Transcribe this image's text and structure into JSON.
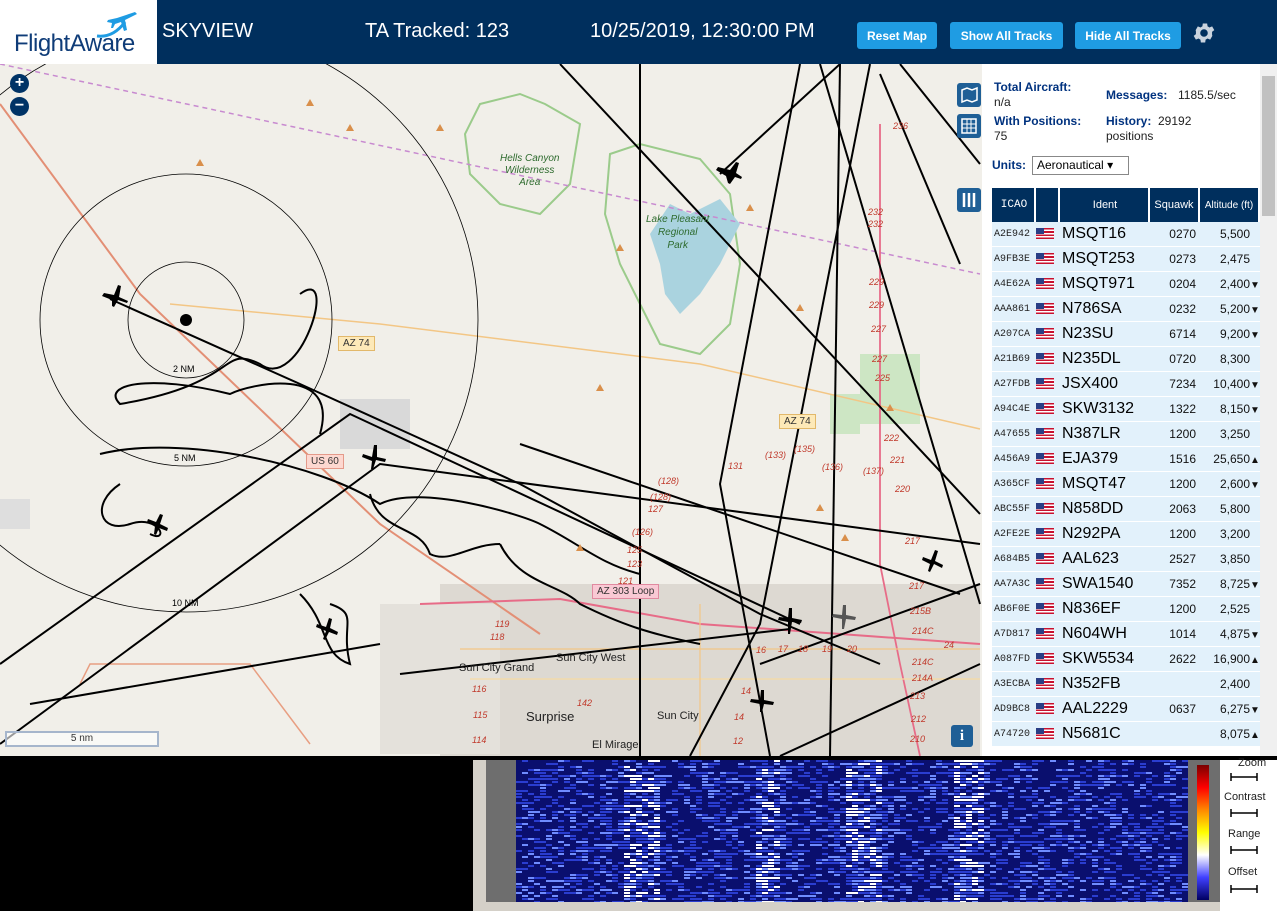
{
  "header": {
    "logo_text": "FlightAware",
    "app_name": "SKYVIEW",
    "tracked": "TA Tracked: 123",
    "datetime": "10/25/2019, 12:30:00 PM",
    "reset_map": "Reset Map",
    "show_all_tracks": "Show All Tracks",
    "hide_all_tracks": "Hide All Tracks"
  },
  "map": {
    "zoom_in": "+",
    "zoom_out": "−",
    "scale_label": "5 nm",
    "info_label": "i",
    "labels": {
      "hells_canyon": [
        "Hells Canyon",
        "Wilderness",
        "Area"
      ],
      "lake_pleasant": [
        "Lake Pleasant",
        "Regional",
        "Park"
      ],
      "az74_a": "AZ 74",
      "az74_b": "AZ 74",
      "us60": "US 60",
      "az303": "AZ 303 Loop",
      "sun_city_grand": "Sun City Grand",
      "sun_city_west": "Sun City West",
      "surprise": "Surprise",
      "sun_city": "Sun City",
      "el_mirage": "El Mirage",
      "ring_2": "2 NM",
      "ring_5": "5 NM",
      "ring_10": "10 NM"
    },
    "altitude_labels": [
      "236",
      "232",
      "232",
      "229",
      "229",
      "227",
      "227",
      "225",
      "222",
      "221",
      "220",
      "217",
      "217",
      "215B",
      "214C",
      "214C",
      "214A",
      "213",
      "212",
      "210",
      "(135)",
      "(133)",
      "(136)",
      "(137)",
      "131",
      "(128)",
      "(128)",
      "127",
      "(126)",
      "125",
      "123",
      "121",
      "119",
      "118",
      "116",
      "115",
      "114",
      "16",
      "17",
      "18",
      "19",
      "20",
      "24",
      "14",
      "14",
      "12",
      "142"
    ]
  },
  "panel": {
    "total_aircraft_label": "Total Aircraft:",
    "total_aircraft_value": "n/a",
    "messages_label": "Messages:",
    "messages_value": "1185.5/sec",
    "with_positions_label": "With Positions:",
    "with_positions_value": "75",
    "history_label": "History:",
    "history_value": "29192",
    "history_unit": "positions",
    "units_label": "Units:",
    "units_value": "Aeronautical",
    "columns": [
      "ICAO",
      "",
      "Ident",
      "Squawk",
      "Altitude (ft)"
    ],
    "rows": [
      {
        "icao": "A2E942",
        "ident": "MSQT16",
        "squawk": "0270",
        "alt": "5,500",
        "trend": ""
      },
      {
        "icao": "A9FB3E",
        "ident": "MSQT253",
        "squawk": "0273",
        "alt": "2,475",
        "trend": ""
      },
      {
        "icao": "A4E62A",
        "ident": "MSQT971",
        "squawk": "0204",
        "alt": "2,400",
        "trend": "▼"
      },
      {
        "icao": "AAA861",
        "ident": "N786SA",
        "squawk": "0232",
        "alt": "5,200",
        "trend": "▼"
      },
      {
        "icao": "A207CA",
        "ident": "N23SU",
        "squawk": "6714",
        "alt": "9,200",
        "trend": "▼"
      },
      {
        "icao": "A21B69",
        "ident": "N235DL",
        "squawk": "0720",
        "alt": "8,300",
        "trend": ""
      },
      {
        "icao": "A27FDB",
        "ident": "JSX400",
        "squawk": "7234",
        "alt": "10,400",
        "trend": "▼"
      },
      {
        "icao": "A94C4E",
        "ident": "SKW3132",
        "squawk": "1322",
        "alt": "8,150",
        "trend": "▼"
      },
      {
        "icao": "A47655",
        "ident": "N387LR",
        "squawk": "1200",
        "alt": "3,250",
        "trend": ""
      },
      {
        "icao": "A456A9",
        "ident": "EJA379",
        "squawk": "1516",
        "alt": "25,650",
        "trend": "▲"
      },
      {
        "icao": "A365CF",
        "ident": "MSQT47",
        "squawk": "1200",
        "alt": "2,600",
        "trend": "▼"
      },
      {
        "icao": "ABC55F",
        "ident": "N858DD",
        "squawk": "2063",
        "alt": "5,800",
        "trend": ""
      },
      {
        "icao": "A2FE2E",
        "ident": "N292PA",
        "squawk": "1200",
        "alt": "3,200",
        "trend": ""
      },
      {
        "icao": "A684B5",
        "ident": "AAL623",
        "squawk": "2527",
        "alt": "3,850",
        "trend": ""
      },
      {
        "icao": "AA7A3C",
        "ident": "SWA1540",
        "squawk": "7352",
        "alt": "8,725",
        "trend": "▼"
      },
      {
        "icao": "AB6F0E",
        "ident": "N836EF",
        "squawk": "1200",
        "alt": "2,525",
        "trend": ""
      },
      {
        "icao": "A7D817",
        "ident": "N604WH",
        "squawk": "1014",
        "alt": "4,875",
        "trend": "▼"
      },
      {
        "icao": "A087FD",
        "ident": "SKW5534",
        "squawk": "2622",
        "alt": "16,900",
        "trend": "▲"
      },
      {
        "icao": "A3ECBA",
        "ident": "N352FB",
        "squawk": "",
        "alt": "2,400",
        "trend": ""
      },
      {
        "icao": "AD9BC8",
        "ident": "AAL2229",
        "squawk": "0637",
        "alt": "6,275",
        "trend": "▼"
      },
      {
        "icao": "A74720",
        "ident": "N5681C",
        "squawk": "",
        "alt": "8,075",
        "trend": "▲"
      }
    ]
  },
  "waterfall": {
    "zoom_label": "Zoom",
    "contrast_label": "Contrast",
    "range_label": "Range",
    "offset_label": "Offset"
  },
  "colors": {
    "header_bg": "#002f5d",
    "button_blue": "#1f9ce3",
    "row_bg": "#e2f1fb"
  }
}
